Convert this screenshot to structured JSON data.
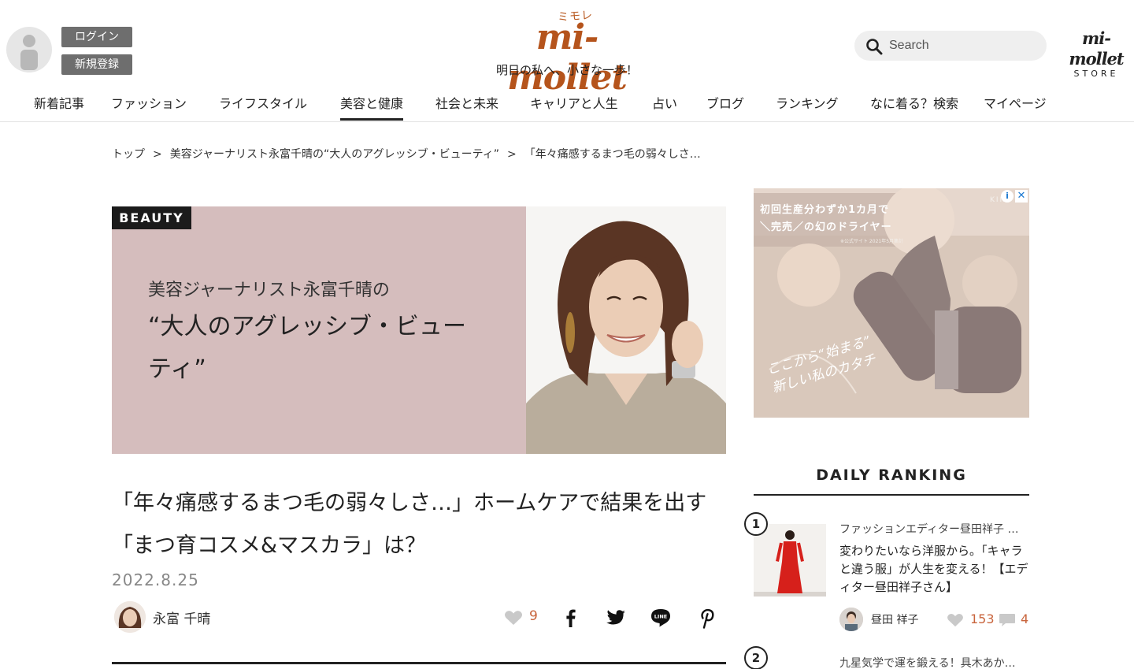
{
  "header": {
    "login_label": "ログイン",
    "register_label": "新規登録",
    "logo_small": "ミモレ",
    "logo_main": "mi-mollet",
    "tagline": "明日の私へ、小さな一歩！",
    "search_placeholder": "Search",
    "store_logo": "mi-mollet",
    "store_sub": "STORE"
  },
  "nav": {
    "items": [
      {
        "label": "新着記事"
      },
      {
        "label": "ファッション"
      },
      {
        "label": "ライフスタイル"
      },
      {
        "label": "美容と健康"
      },
      {
        "label": "社会と未来"
      },
      {
        "label": "キャリアと人生"
      },
      {
        "label": "占い"
      },
      {
        "label": "ブログ"
      },
      {
        "label": "ランキング"
      },
      {
        "label": "なに着る？検索"
      },
      {
        "label": "マイページ"
      }
    ],
    "active": "美容と健康"
  },
  "breadcrumb": {
    "items": [
      "トップ",
      "美容ジャーナリスト永富千晴の“大人のアグレッシブ・ビューティ”",
      "「年々痛感するまつ毛の弱々しさ…"
    ],
    "separator": ">"
  },
  "hero": {
    "badge": "BEAUTY",
    "subtitle": "美容ジャーナリスト永富千晴の",
    "title": "“大人のアグレッシブ・ビューティ”",
    "bg_color": "#d5bdbd"
  },
  "article": {
    "title": "「年々痛感するまつ毛の弱々しさ…」ホームケアで結果を出す「まつ育コスメ&マスカラ」は？",
    "date": "2022.8.25",
    "author": "永富 千晴",
    "likes": "9",
    "share_icons": [
      "facebook-icon",
      "twitter-icon",
      "line-icon",
      "pinterest-icon"
    ]
  },
  "ad": {
    "line1": "初回生産分わずか1カ月で",
    "line2": "＼完売／の幻のドライヤー",
    "note": "※公式サイト 2021年5月集計",
    "script1": "ここから“始まる”",
    "script2": "新しい私のカタチ",
    "brand": "KINU",
    "info": "i",
    "close": "✕"
  },
  "ranking": {
    "title": "DAILY RANKING",
    "items": [
      {
        "rank": "1",
        "category": "ファッションエディター昼田祥子 …",
        "title": "変わりたいなら洋服から。「キャラと違う服」が人生を変える！【エディター昼田祥子さん】",
        "author": "昼田 祥子",
        "likes": "153",
        "comments": "4"
      },
      {
        "rank": "2",
        "category": "九星気学で運を鍛える！具木あか…"
      }
    ]
  },
  "colors": {
    "brand": "#b5541c",
    "like": "#c8643c",
    "hero_bg": "#d5bdbd"
  }
}
